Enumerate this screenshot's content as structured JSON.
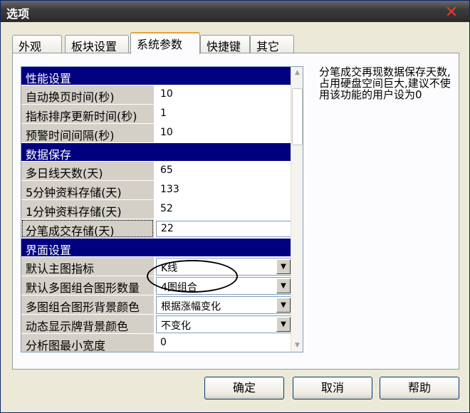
{
  "window": {
    "title": "选项"
  },
  "tabs": [
    "外观",
    "板块设置",
    "系统参数",
    "快捷键",
    "其它"
  ],
  "active_tab": "系统参数",
  "sections": [
    {
      "title": "性能设置",
      "rows": [
        {
          "label": "自动换页时间(秒)",
          "value": "10"
        },
        {
          "label": "指标排序更新时间(秒)",
          "value": "1"
        },
        {
          "label": "预警时间间隔(秒)",
          "value": "10"
        }
      ]
    },
    {
      "title": "数据保存",
      "rows": [
        {
          "label": "多日线天数(天)",
          "value": "65"
        },
        {
          "label": "5分钟资料存储(天)",
          "value": "133"
        },
        {
          "label": "1分钟资料存储(天)",
          "value": "52"
        },
        {
          "label": "分笔成交存储(天)",
          "value": "22"
        }
      ]
    },
    {
      "title": "界面设置",
      "rows": [
        {
          "label": "默认主图指标",
          "value": "K线"
        },
        {
          "label": "默认多图组合图形数量",
          "value": "4图组合"
        },
        {
          "label": "多图组合图形背景颜色",
          "value": "根据涨幅变化"
        },
        {
          "label": "动态显示牌背景颜色",
          "value": "不变化"
        },
        {
          "label": "分析图最小宽度",
          "value": "0"
        }
      ]
    }
  ],
  "description": "分笔成交再现数据保存天数,占用硬盘空间巨大,建议不使用该功能的用户设为0",
  "buttons": {
    "ok": "确定",
    "cancel": "取消",
    "help": "帮助"
  },
  "icons": {
    "close": "close-icon",
    "scroll_up": "arrow-up-icon",
    "scroll_down": "arrow-down-icon",
    "dropdown": "chevron-down-icon"
  }
}
